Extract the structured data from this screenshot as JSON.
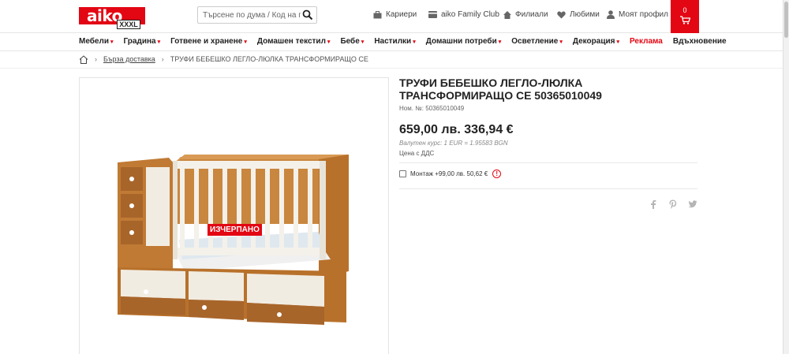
{
  "header": {
    "logo_text": "aiko",
    "logo_sub": "XXXL",
    "search_placeholder": "Търсене по дума / Код на про",
    "nav": {
      "careers": "Кариери",
      "family_club": "aiko Family Club",
      "branches": "Филиали",
      "favorites": "Любими",
      "profile": "Моят профил"
    },
    "cart_count": "0"
  },
  "categories": [
    {
      "label": "Мебели",
      "arrow": "▾"
    },
    {
      "label": "Градина",
      "arrow": "▾"
    },
    {
      "label": "Готвене и хранене",
      "arrow": "▾"
    },
    {
      "label": "Домашен текстил",
      "arrow": "▾"
    },
    {
      "label": "Бебе",
      "arrow": "▾"
    },
    {
      "label": "Настилки",
      "arrow": "▾"
    },
    {
      "label": "Домашни потреби",
      "arrow": "▾"
    },
    {
      "label": "Осветление",
      "arrow": "▾"
    },
    {
      "label": "Декорация",
      "arrow": "▾"
    },
    {
      "label": "Реклама",
      "arrow": ""
    },
    {
      "label": "Вдъхновение",
      "arrow": ""
    }
  ],
  "breadcrumb": {
    "sep": "›",
    "level1": "Бърза доставка",
    "current": "ТРУФИ БЕБЕШКО ЛЕГЛО-ЛЮЛКА ТРАНСФОРМИРАЩО СЕ"
  },
  "product": {
    "title": "ТРУФИ БЕБЕШКО ЛЕГЛО-ЛЮЛКА ТРАНСФОРМИРАЩО СЕ 50365010049",
    "article_no": "Ном. №: 50365010049",
    "price": "659,00 лв. 336,94 €",
    "exchange_rate": "Валутен курс: 1 EUR = 1.95583 BGN",
    "vat_note": "Цена с ДДС",
    "assembly_label": "Монтаж +99,00 лв. 50,62 €",
    "assembly_info": "!",
    "sold_out_badge": "ИЗЧЕРПАНО"
  },
  "colors": {
    "brand_red": "#e30613"
  }
}
